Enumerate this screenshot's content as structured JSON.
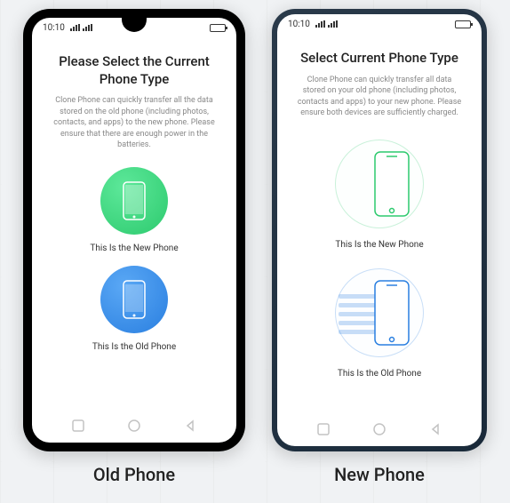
{
  "status": {
    "time": "10:10"
  },
  "old": {
    "heading": "Please Select the Current Phone Type",
    "subtext": "Clone Phone can quickly transfer all the data stored on the old phone (including photos, contacts, and apps) to the new phone. Please ensure that there are enough power in the batteries.",
    "new_label": "This Is the New Phone",
    "old_label": "This Is the Old Phone"
  },
  "new": {
    "heading": "Select Current Phone Type",
    "subtext": "Clone Phone can quickly transfer all data stored on your old phone (including photos, contacts and apps) to your new phone. Please ensure both devices are sufficiently charged.",
    "new_label": "This Is the New Phone",
    "old_label": "This Is the Old Phone"
  },
  "labels": {
    "old_phone": "Old Phone",
    "new_phone": "New Phone"
  }
}
